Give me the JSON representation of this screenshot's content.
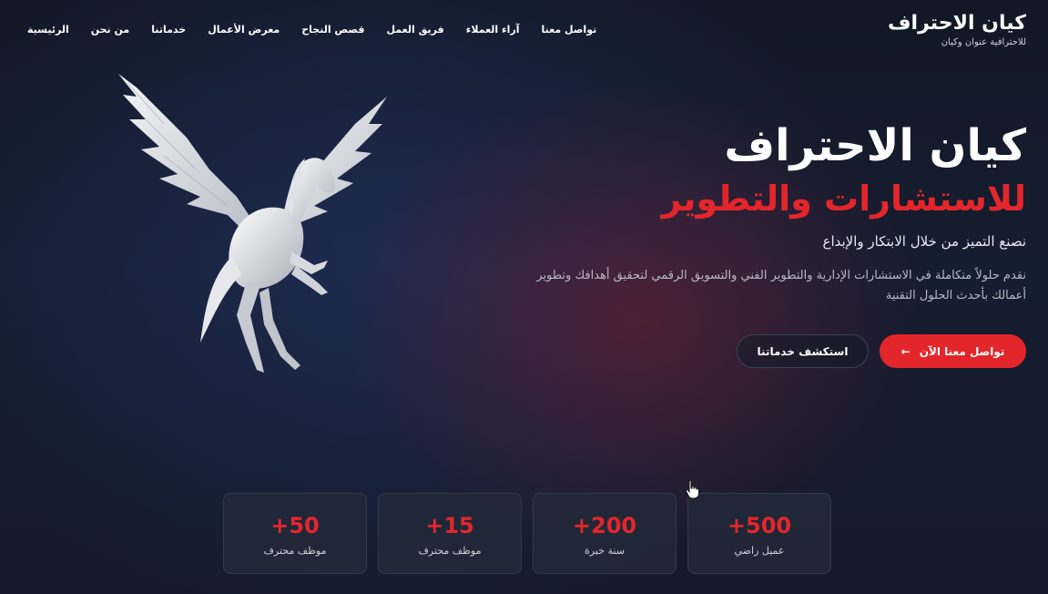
{
  "logo": {
    "title": "كيان الاحتراف",
    "subtitle": "للاحترافية عنوان وكيان"
  },
  "nav": {
    "items": [
      "الرئيسية",
      "من نحن",
      "خدماتنا",
      "معرض الأعمال",
      "قصص النجاح",
      "فريق العمل",
      "آراء العملاء",
      "تواصل معنا"
    ]
  },
  "hero": {
    "title": "كيان الاحتراف",
    "subtitle": "للاستشارات والتطوير",
    "tagline": "نصنع التميز من خلال الابتكار والإبداع",
    "description": "نقدم حلولاً متكاملة في الاستشارات الإدارية والتطوير الفني والتسويق الرقمي لتحقيق أهدافك وتطوير أعمالك بأحدث الحلول التقنية",
    "primary_button": "تواصل معنا الآن",
    "secondary_button": "استكشف خدماتنا",
    "primary_icon": "arrow-left-icon"
  },
  "stats": [
    {
      "value": "+500",
      "label": "عميل راضي"
    },
    {
      "value": "+200",
      "label": "سنة خبرة"
    },
    {
      "value": "+15",
      "label": "موظف محترف"
    },
    {
      "value": "+50",
      "label": "موظف محترف"
    }
  ],
  "colors": {
    "accent": "#e3262b",
    "background": "#141a2a"
  }
}
